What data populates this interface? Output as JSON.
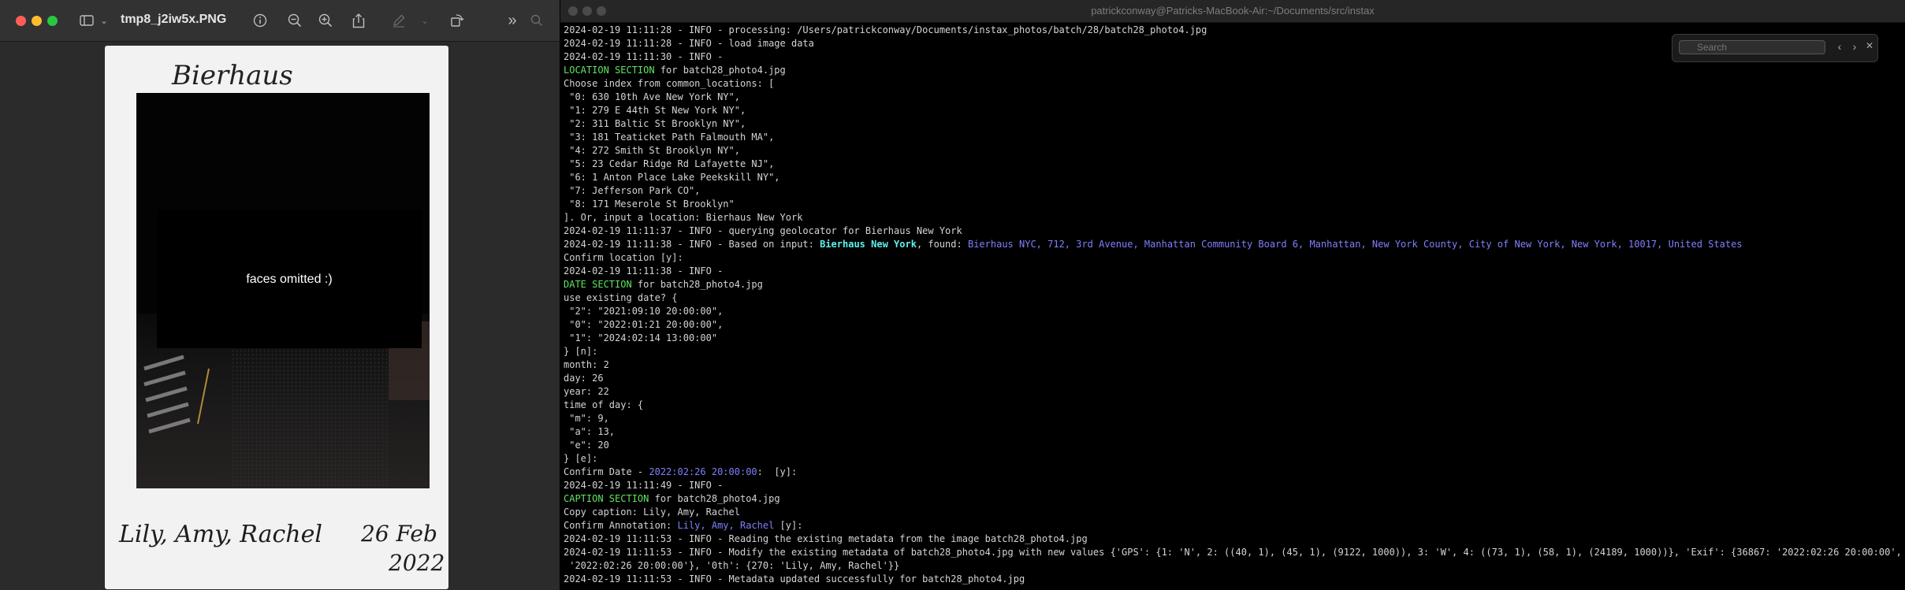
{
  "preview": {
    "filename": "tmp8_j2iw5x.PNG",
    "photo": {
      "top_handwriting": "Bierhaus",
      "redaction_text": "faces omitted :)",
      "bottom_names": "Lily, Amy, Rachel",
      "bottom_date_line1": "26 Feb",
      "bottom_date_line2": "2022"
    },
    "toolbar_icons": [
      "sidebar-icon",
      "chevron-down-icon",
      "info-icon",
      "zoom-out-icon",
      "zoom-in-icon",
      "share-icon",
      "markup-icon",
      "rotate-icon",
      "more-icon",
      "search-icon"
    ]
  },
  "terminal": {
    "title": "patrickconway@Patricks-MacBook-Air:~/Documents/src/instax",
    "search_placeholder": "Search",
    "lines": [
      [
        {
          "t": "2024-02-19 11:11:28 - INFO - processing: /Users/patrickconway/Documents/instax_photos/batch/28/batch28_photo4.jpg"
        }
      ],
      [
        {
          "t": "2024-02-19 11:11:28 - INFO - load image data"
        }
      ],
      [
        {
          "t": "2024-02-19 11:11:30 - INFO -"
        }
      ],
      [
        {
          "t": "LOCATION SECTION",
          "c": "g"
        },
        {
          "t": " for batch28_photo4.jpg"
        }
      ],
      [
        {
          "t": "Choose index from common_locations: ["
        }
      ],
      [
        {
          "t": " \"0: 630 10th Ave New York NY\","
        }
      ],
      [
        {
          "t": " \"1: 279 E 44th St New York NY\","
        }
      ],
      [
        {
          "t": " \"2: 311 Baltic St Brooklyn NY\","
        }
      ],
      [
        {
          "t": " \"3: 181 Teaticket Path Falmouth MA\","
        }
      ],
      [
        {
          "t": " \"4: 272 Smith St Brooklyn NY\","
        }
      ],
      [
        {
          "t": " \"5: 23 Cedar Ridge Rd Lafayette NJ\","
        }
      ],
      [
        {
          "t": " \"6: 1 Anton Place Lake Peekskill NY\","
        }
      ],
      [
        {
          "t": " \"7: Jefferson Park CO\","
        }
      ],
      [
        {
          "t": " \"8: 171 Meserole St Brooklyn\""
        }
      ],
      [
        {
          "t": "]. Or, input a location: Bierhaus New York"
        }
      ],
      [
        {
          "t": "2024-02-19 11:11:37 - INFO - querying geolocator for Bierhaus New York"
        }
      ],
      [
        {
          "t": "2024-02-19 11:11:38 - INFO - Based on input: "
        },
        {
          "t": "Bierhaus New York",
          "c": "c"
        },
        {
          "t": ", found: "
        },
        {
          "t": "Bierhaus NYC, 712, 3rd Avenue, Manhattan Community Board 6, Manhattan, New York County, City of New York, New York, 10017, United States",
          "c": "b"
        }
      ],
      [
        {
          "t": "Confirm location [y]:"
        }
      ],
      [
        {
          "t": "2024-02-19 11:11:38 - INFO -"
        }
      ],
      [
        {
          "t": "DATE SECTION",
          "c": "g"
        },
        {
          "t": " for batch28_photo4.jpg"
        }
      ],
      [
        {
          "t": "use existing date? {"
        }
      ],
      [
        {
          "t": " \"2\": \"2021:09:10 20:00:00\","
        }
      ],
      [
        {
          "t": " \"0\": \"2022:01:21 20:00:00\","
        }
      ],
      [
        {
          "t": " \"1\": \"2024:02:14 13:00:00\""
        }
      ],
      [
        {
          "t": "} [n]:"
        }
      ],
      [
        {
          "t": "month: 2"
        }
      ],
      [
        {
          "t": "day: 26"
        }
      ],
      [
        {
          "t": "year: 22"
        }
      ],
      [
        {
          "t": "time of day: {"
        }
      ],
      [
        {
          "t": " \"m\": 9,"
        }
      ],
      [
        {
          "t": " \"a\": 13,"
        }
      ],
      [
        {
          "t": " \"e\": 20"
        }
      ],
      [
        {
          "t": "} [e]:"
        }
      ],
      [
        {
          "t": "Confirm Date - "
        },
        {
          "t": "2022:02:26 20:00:00",
          "c": "b"
        },
        {
          "t": ":  [y]:"
        }
      ],
      [
        {
          "t": "2024-02-19 11:11:49 - INFO -"
        }
      ],
      [
        {
          "t": "CAPTION SECTION",
          "c": "g"
        },
        {
          "t": " for batch28_photo4.jpg"
        }
      ],
      [
        {
          "t": "Copy caption: Lily, Amy, Rachel"
        }
      ],
      [
        {
          "t": "Confirm Annotation: "
        },
        {
          "t": "Lily, Amy, Rachel",
          "c": "b"
        },
        {
          "t": " [y]:"
        }
      ],
      [
        {
          "t": "2024-02-19 11:11:53 - INFO - Reading the existing metadata from the image batch28_photo4.jpg"
        }
      ],
      [
        {
          "t": "2024-02-19 11:11:53 - INFO - Modify the existing metadata of batch28_photo4.jpg with new values {'GPS': {1: 'N', 2: ((40, 1), (45, 1), (9122, 1000)), 3: 'W', 4: ((73, 1), (58, 1), (24189, 1000))}, 'Exif': {36867: '2022:02:26 20:00:00', 36868:"
        }
      ],
      [
        {
          "t": " '2022:02:26 20:00:00'}, '0th': {270: 'Lily, Amy, Rachel'}}"
        }
      ],
      [
        {
          "t": "2024-02-19 11:11:53 - INFO - Metadata updated successfully for batch28_photo4.jpg"
        }
      ]
    ]
  },
  "colors": {
    "green": "#5fe45f",
    "blue": "#7f7fff",
    "cyan": "#5ff0f0"
  }
}
